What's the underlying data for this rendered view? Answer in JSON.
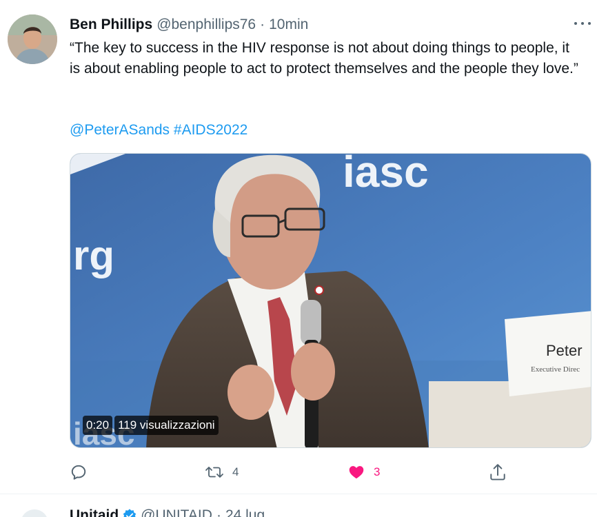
{
  "tweet": {
    "author_name": "Ben Phillips",
    "handle": "@benphillips76",
    "separator": "·",
    "time": "10min",
    "text": "“The key to success in the HIV response is not about doing things to people, it is about enabling people to act to protect themselves and the people they love.”",
    "mention": "@PeterASands",
    "hashtag": "#AIDS2022",
    "media": {
      "duration": "0:20",
      "views": "119 visualizzazioni",
      "backdrop_text": "iasc",
      "backdrop_text_left": "rg",
      "nameplate_name": "Peter",
      "nameplate_title": "Executive Direc",
      "backdrop_text_bottom": "iasc"
    },
    "actions": {
      "reply_count": "",
      "retweet_count": "4",
      "like_count": "3",
      "liked": true
    }
  },
  "next_tweet": {
    "author_name": "Unitaid",
    "handle": "@UNITAID",
    "separator": "·",
    "time": "24 lug"
  },
  "colors": {
    "link": "#1d9bf0",
    "like": "#f91880",
    "secondary_text": "#536471"
  },
  "icons": [
    "more-icon",
    "reply-icon",
    "retweet-icon",
    "heart-icon",
    "share-icon",
    "verified-icon"
  ]
}
